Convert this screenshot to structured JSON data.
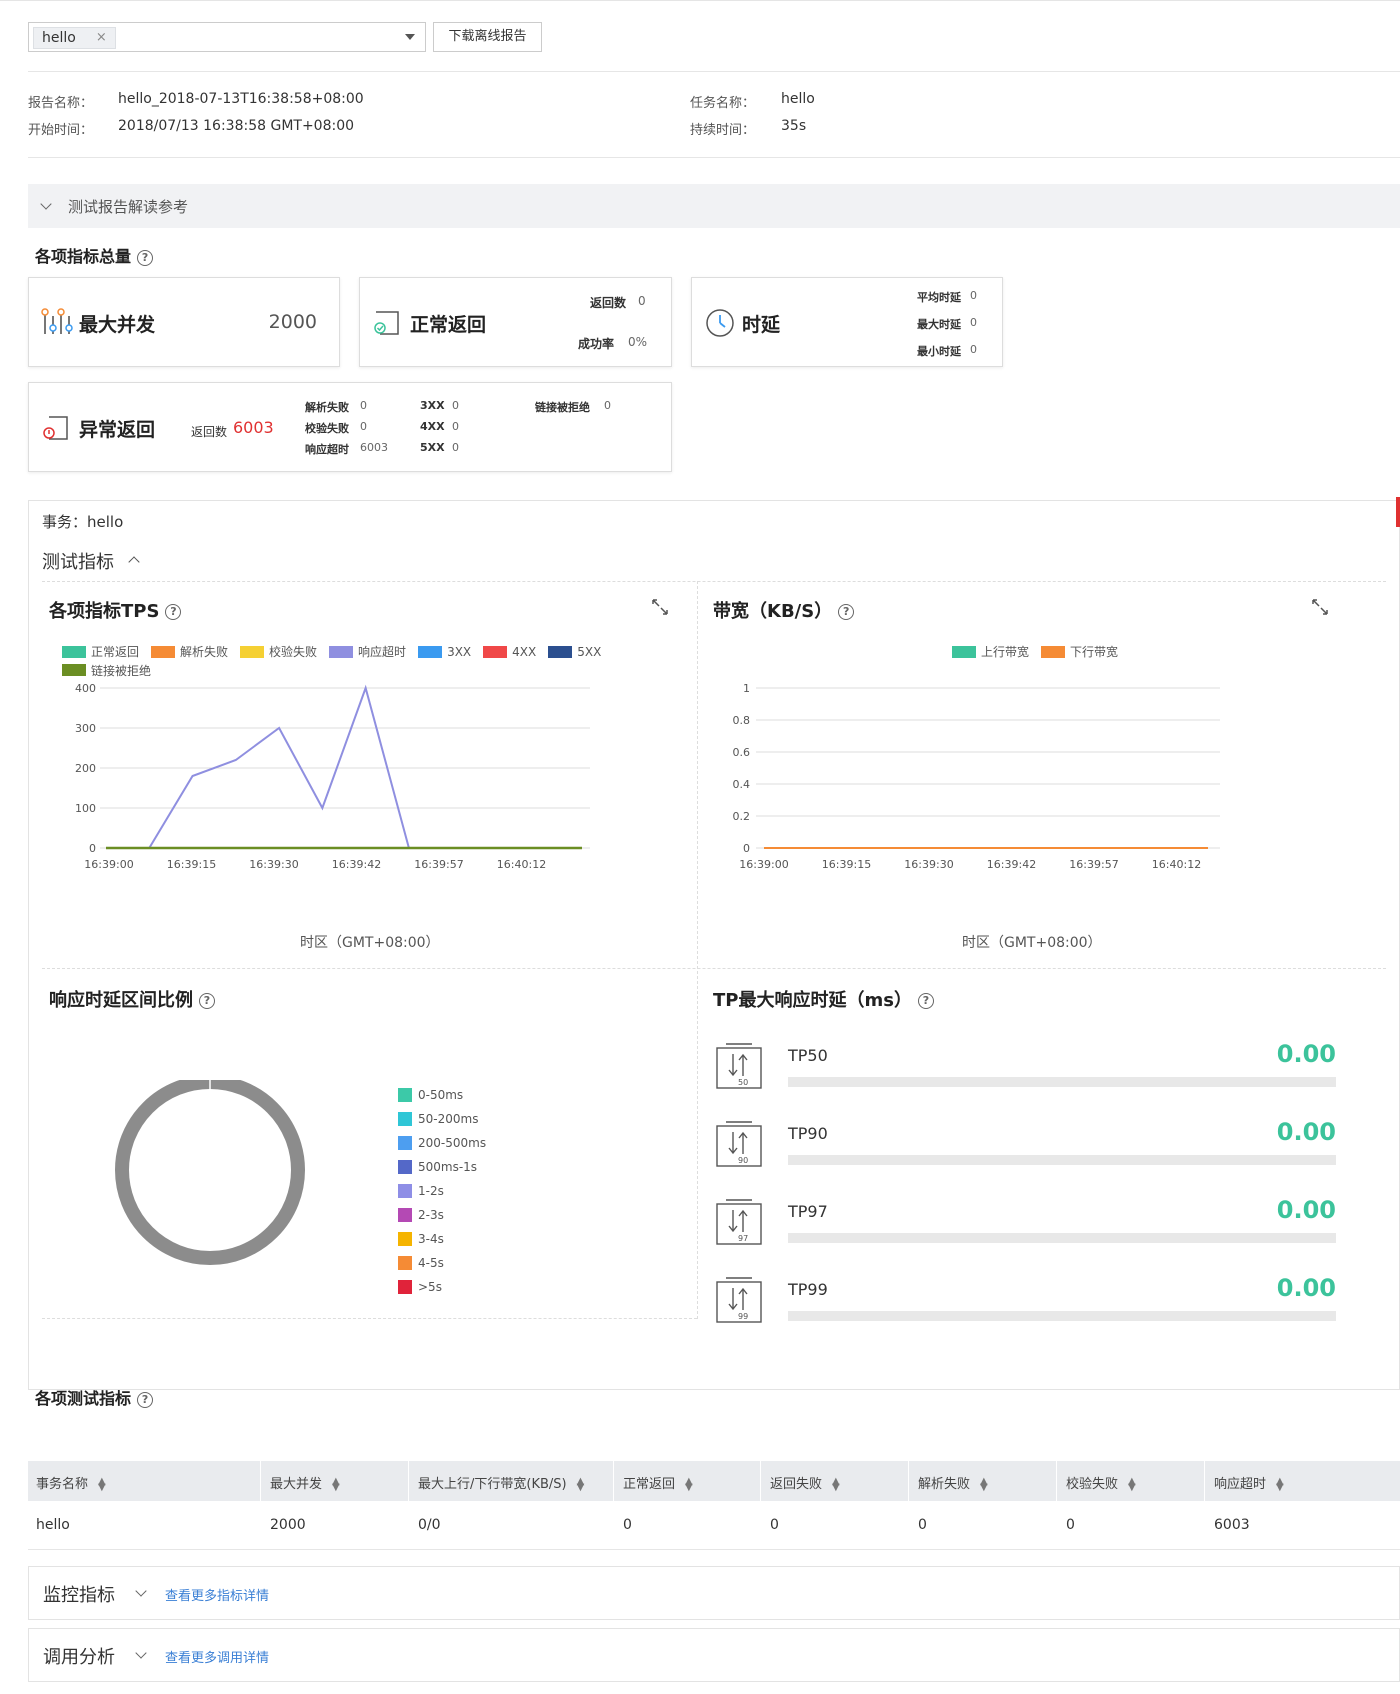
{
  "toolbar": {
    "selected_tag": "hello",
    "tag_remove": "×",
    "download_label": "下载离线报告"
  },
  "info": {
    "report_name_label": "报告名称：",
    "report_name": "hello_2018-07-13T16:38:58+08:00",
    "start_time_label": "开始时间：",
    "start_time": "2018/07/13 16:38:58 GMT+08:00",
    "task_name_label": "任务名称：",
    "task_name": "hello",
    "duration_label": "持续时间：",
    "duration": "35s"
  },
  "guide": {
    "label": "测试报告解读参考"
  },
  "summary": {
    "title": "各项指标总量",
    "max_concurrency": {
      "label": "最大并发",
      "value": "2000"
    },
    "normal_return": {
      "label": "正常返回",
      "return_count_label": "返回数",
      "return_count": "0",
      "success_rate_label": "成功率",
      "success_rate": "0%"
    },
    "latency": {
      "label": "时延",
      "avg_label": "平均时延",
      "avg": "0",
      "max_label": "最大时延",
      "max": "0",
      "min_label": "最小时延",
      "min": "0"
    },
    "abnormal": {
      "label": "异常返回",
      "return_count_label": "返回数",
      "return_count": "6003",
      "parse_fail_label": "解析失败",
      "parse_fail": "0",
      "verify_fail_label": "校验失败",
      "verify_fail": "0",
      "timeout_label": "响应超时",
      "timeout": "6003",
      "x3_label": "3XX",
      "x3": "0",
      "x4_label": "4XX",
      "x4": "0",
      "x5_label": "5XX",
      "x5": "0",
      "refused_label": "链接被拒绝",
      "refused": "0"
    }
  },
  "transaction": {
    "label": "事务：hello",
    "metrics_toggle": "测试指标"
  },
  "charts": {
    "tps_title": "各项指标TPS",
    "bandwidth_title": "带宽（KB/S）",
    "latency_ratio_title": "响应时延区间比例",
    "tp_title": "TP最大响应时延（ms）",
    "timezone_label": "时区（GMT+08:00）"
  },
  "chart_data": [
    {
      "type": "line",
      "title": "各项指标TPS",
      "xlabel": "时区（GMT+08:00）",
      "x": [
        "16:39:00",
        "16:39:05",
        "16:39:10",
        "16:39:15",
        "16:39:20",
        "16:39:25",
        "16:39:30",
        "16:39:35",
        "16:39:42",
        "16:39:57",
        "16:40:12",
        "16:40:17"
      ],
      "x_ticks": [
        "16:39:00",
        "16:39:15",
        "16:39:30",
        "16:39:42",
        "16:39:57",
        "16:40:12"
      ],
      "ylim": [
        0,
        400
      ],
      "y_ticks": [
        0,
        100,
        200,
        300,
        400
      ],
      "legend_position": "top",
      "series": [
        {
          "name": "正常返回",
          "color": "#3cc39b",
          "values": [
            0,
            0,
            0,
            0,
            0,
            0,
            0,
            0,
            0,
            0,
            0,
            0
          ]
        },
        {
          "name": "解析失败",
          "color": "#f58b35",
          "values": [
            0,
            0,
            0,
            0,
            0,
            0,
            0,
            0,
            0,
            0,
            0,
            0
          ]
        },
        {
          "name": "校验失败",
          "color": "#f5d033",
          "values": [
            0,
            0,
            0,
            0,
            0,
            0,
            0,
            0,
            0,
            0,
            0,
            0
          ]
        },
        {
          "name": "响应超时",
          "color": "#8f8fe0",
          "values": [
            0,
            0,
            180,
            220,
            300,
            100,
            400,
            0,
            0,
            0,
            0,
            0
          ]
        },
        {
          "name": "3XX",
          "color": "#3a9af0",
          "values": [
            0,
            0,
            0,
            0,
            0,
            0,
            0,
            0,
            0,
            0,
            0,
            0
          ]
        },
        {
          "name": "4XX",
          "color": "#f04848",
          "values": [
            0,
            0,
            0,
            0,
            0,
            0,
            0,
            0,
            0,
            0,
            0,
            0
          ]
        },
        {
          "name": "5XX",
          "color": "#2b4f8f",
          "values": [
            0,
            0,
            0,
            0,
            0,
            0,
            0,
            0,
            0,
            0,
            0,
            0
          ]
        },
        {
          "name": "链接被拒绝",
          "color": "#6b8e23",
          "values": [
            0,
            0,
            0,
            0,
            0,
            0,
            0,
            0,
            0,
            0,
            0,
            0
          ]
        }
      ]
    },
    {
      "type": "line",
      "title": "带宽（KB/S）",
      "xlabel": "时区（GMT+08:00）",
      "x_ticks": [
        "16:39:00",
        "16:39:15",
        "16:39:30",
        "16:39:42",
        "16:39:57",
        "16:40:12"
      ],
      "ylim": [
        0,
        1
      ],
      "y_ticks": [
        "0",
        "0.2",
        "0.4",
        "0.6",
        "0.8",
        "1"
      ],
      "legend_position": "top",
      "series": [
        {
          "name": "上行带宽",
          "color": "#3cc39b",
          "values": [
            0,
            0,
            0,
            0,
            0,
            0
          ]
        },
        {
          "name": "下行带宽",
          "color": "#f58b35",
          "values": [
            0,
            0,
            0,
            0,
            0,
            0
          ]
        }
      ]
    },
    {
      "type": "pie",
      "title": "响应时延区间比例",
      "categories": [
        "0-50ms",
        "50-200ms",
        "200-500ms",
        "500ms-1s",
        "1-2s",
        "2-3s",
        "3-4s",
        "4-5s",
        ">5s"
      ],
      "colors": [
        "#3cc9a8",
        "#2fc6d6",
        "#4d9ef0",
        "#5468c8",
        "#8e8ee6",
        "#b449b4",
        "#f5b400",
        "#f58b35",
        "#e0233a"
      ],
      "values": [
        0,
        0,
        0,
        0,
        0,
        0,
        0,
        0,
        0
      ],
      "empty_ring_color": "#8c8c8c"
    }
  ],
  "tp": {
    "items": [
      {
        "label": "TP50",
        "num": "50",
        "value": "0.00"
      },
      {
        "label": "TP90",
        "num": "90",
        "value": "0.00"
      },
      {
        "label": "TP97",
        "num": "97",
        "value": "0.00"
      },
      {
        "label": "TP99",
        "num": "99",
        "value": "0.00"
      }
    ]
  },
  "table": {
    "title": "各项测试指标",
    "headers": [
      "事务名称",
      "最大并发",
      "最大上行/下行带宽(KB/S)",
      "正常返回",
      "返回失败",
      "解析失败",
      "校验失败",
      "响应超时"
    ],
    "rows": [
      [
        "hello",
        "2000",
        "0/0",
        "0",
        "0",
        "0",
        "0",
        "6003"
      ]
    ]
  },
  "footer": {
    "monitor_label": "监控指标",
    "monitor_link": "查看更多指标详情",
    "call_label": "调用分析",
    "call_link": "查看更多调用详情"
  }
}
